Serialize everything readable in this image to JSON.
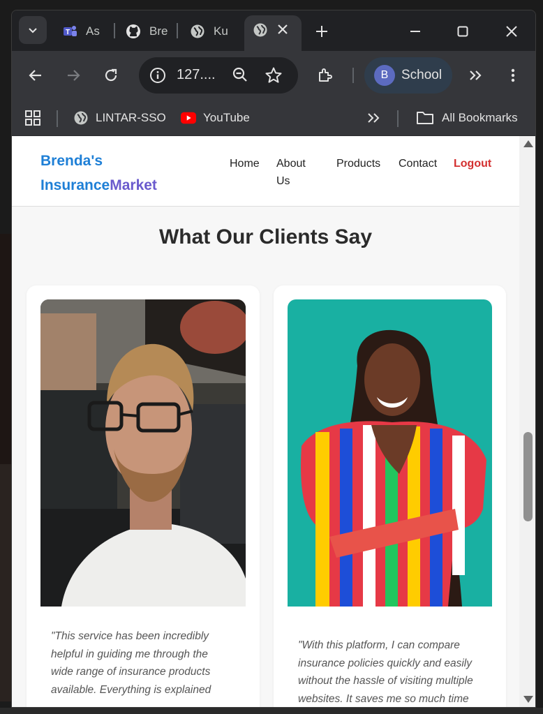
{
  "browser": {
    "tabs": [
      {
        "label": "As",
        "icon": "teams-icon"
      },
      {
        "label": "Bre",
        "icon": "github-icon"
      },
      {
        "label": "Ku",
        "icon": "globe-icon"
      },
      {
        "label": "",
        "icon": "globe-icon",
        "active": true
      }
    ],
    "new_tab_label": "+",
    "omnibox": {
      "url": "127...."
    },
    "profile": {
      "initial": "B",
      "name": "School"
    },
    "bookmarks": [
      {
        "label": "LINTAR-SSO",
        "icon": "globe-icon"
      },
      {
        "label": "YouTube",
        "icon": "youtube-icon"
      }
    ],
    "all_bookmarks_label": "All Bookmarks"
  },
  "site": {
    "brand": {
      "part1": "Brenda's",
      "part2a": "Insurance",
      "part2b": "Market"
    },
    "nav": {
      "home": "Home",
      "about_line1": "About",
      "about_line2": "Us",
      "products": "Products",
      "contact": "Contact",
      "logout": "Logout"
    },
    "section_title": "What Our Clients Say",
    "testimonials": [
      {
        "quote_lines": [
          "\"This service has been incredibly",
          "helpful in guiding me through the",
          "wide range of insurance products",
          "available. Everything is explained"
        ]
      },
      {
        "quote_lines": [
          "\"With this platform, I can compare",
          "insurance policies quickly and easily",
          "without the hassle of visiting multiple",
          "websites. It saves me so much time"
        ]
      }
    ]
  },
  "colors": {
    "brand_blue": "#1e7fd6",
    "brand_purple": "#6a5acd",
    "logout_red": "#d32f2f",
    "chrome_dark": "#202124",
    "chrome_toolbar": "#35363a"
  }
}
